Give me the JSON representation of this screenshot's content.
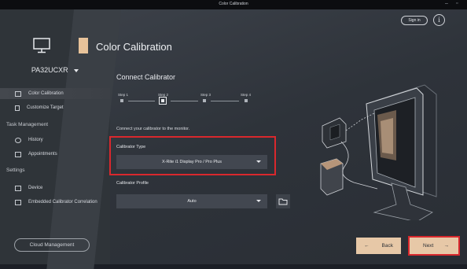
{
  "window": {
    "title": "Color Calibration",
    "controls": [
      "–",
      "▫"
    ]
  },
  "sidebar": {
    "model_name": "PA32UCXR",
    "nav_top": [
      {
        "label": "Color Calibration",
        "icon": "calibration-icon",
        "active": true
      },
      {
        "label": "Customize Target",
        "icon": "target-icon",
        "active": false
      }
    ],
    "task_management": {
      "title": "Task Management",
      "items": [
        {
          "label": "History",
          "icon": "history-icon"
        },
        {
          "label": "Appointments",
          "icon": "calendar-icon"
        }
      ]
    },
    "settings": {
      "title": "Settings",
      "items": [
        {
          "label": "Device",
          "icon": "device-icon"
        },
        {
          "label": "Embedded Calibrator Correlation",
          "icon": "correlation-icon"
        }
      ]
    },
    "cloud_button": "Cloud Management"
  },
  "header": {
    "page_title": "Color Calibration",
    "signin_label": "Sign in",
    "info_glyph": "i"
  },
  "main": {
    "section_title": "Connect Calibrator",
    "steps": [
      {
        "label": "Step 1",
        "current": false
      },
      {
        "label": "Step 2",
        "current": true
      },
      {
        "label": "Step 3",
        "current": false
      },
      {
        "label": "Step 4",
        "current": false
      }
    ],
    "instruction": "Connect your calibrator to the monitor.",
    "calibrator_type": {
      "label": "Calibrator Type",
      "value": "X-Rite i1 Display Pro / Pro Plus"
    },
    "calibrator_profile": {
      "label": "Calibrator Profile",
      "value": "Auto"
    }
  },
  "footer": {
    "back_label": "Back",
    "next_label": "Next"
  },
  "colors": {
    "accent": "#e7c8a7",
    "highlight": "#d9282d",
    "sidebar_bg": "#2f3439"
  }
}
